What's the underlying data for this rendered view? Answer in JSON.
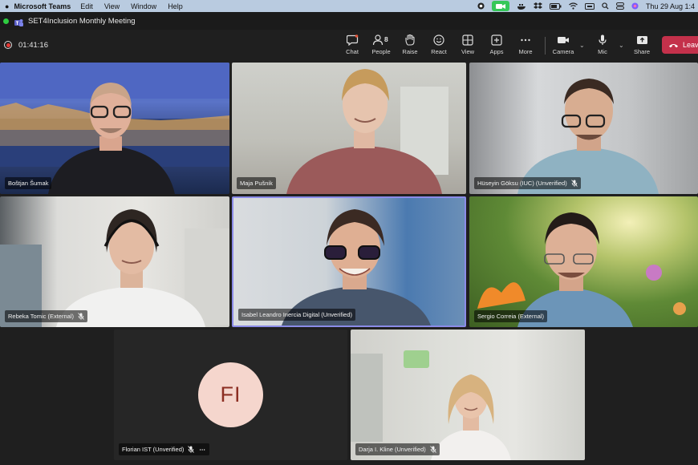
{
  "menubar": {
    "app_name": "Microsoft Teams",
    "items": [
      "Edit",
      "View",
      "Window",
      "Help"
    ],
    "clock": "Thu 29 Aug  1:4"
  },
  "window": {
    "title": "SET4Inclusion Monthly Meeting"
  },
  "toolbar": {
    "timer": "01:41:16",
    "people_count": "8",
    "buttons": {
      "chat": "Chat",
      "people": "People",
      "raise": "Raise",
      "react": "React",
      "view": "View",
      "apps": "Apps",
      "more": "More",
      "camera": "Camera",
      "mic": "Mic",
      "share": "Share"
    },
    "leave_label": "Leav"
  },
  "participants": [
    {
      "name": "Boštjan Šumak",
      "muted": false
    },
    {
      "name": "Maja Pušnik",
      "muted": false
    },
    {
      "name": "Hüseyin Göksu (IUC) (Unverified)",
      "muted": true
    },
    {
      "name": "Rebeka Tomic (External)",
      "muted": true
    },
    {
      "name": "Isabel Leandro Inercia Digital (Unverified)",
      "muted": false
    },
    {
      "name": "Sergio Correia (External)",
      "muted": false
    },
    {
      "name": "Florian IST (Unverified)",
      "muted": true,
      "initials": "FI"
    },
    {
      "name": "Darja I. Kline (Unverified)",
      "muted": true
    }
  ]
}
